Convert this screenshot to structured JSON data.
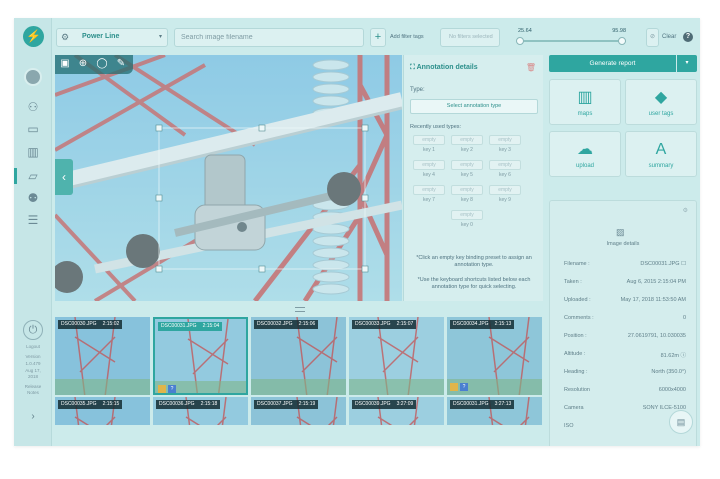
{
  "app": {
    "logo_glyph": "⚡",
    "accent": "#2fa6a0"
  },
  "sidebar": {
    "items": [
      {
        "name": "user-icon",
        "glyph": "⚇"
      },
      {
        "name": "card-icon",
        "glyph": "▭"
      },
      {
        "name": "chart-icon",
        "glyph": "▥"
      },
      {
        "name": "map-icon",
        "glyph": "▱"
      },
      {
        "name": "team-icon",
        "glyph": "⚉"
      },
      {
        "name": "list-icon",
        "glyph": "☰"
      }
    ],
    "power_glyph": "⏻",
    "version_lines": [
      "Logout",
      "Version",
      "1.0.479",
      "Aug 17,",
      "2018",
      "Release",
      "Notes"
    ],
    "expand_glyph": "›"
  },
  "topbar": {
    "project_icon": "⚙",
    "project_name": "Power Line",
    "project_caret": "▾",
    "search_placeholder": "Search image filename",
    "add_filter_glyph": "+",
    "add_filter_label": "Add filter tags",
    "no_filters_label": "No filters selected",
    "range_low": "25.64",
    "range_high": "95.98",
    "range_low_fraction": 0.02,
    "range_high_fraction": 0.96,
    "clear_glyph": "⊘",
    "clear_label": "Clear",
    "help_glyph": "?"
  },
  "viewer": {
    "tools": [
      "▣",
      "⊕",
      "◯",
      "✎"
    ],
    "prev_glyph": "‹"
  },
  "annotation": {
    "title_glyph": "⛶",
    "title": "Annotation details",
    "delete_glyph": "🗑",
    "type_label": "Type:",
    "select_button": "Select annotation type",
    "recent_label": "Recently used types:",
    "keys": [
      {
        "btn": "empty",
        "label": "key 1"
      },
      {
        "btn": "empty",
        "label": "key 2"
      },
      {
        "btn": "empty",
        "label": "key 3"
      },
      {
        "btn": "empty",
        "label": "key 4"
      },
      {
        "btn": "empty",
        "label": "key 5"
      },
      {
        "btn": "empty",
        "label": "key 6"
      },
      {
        "btn": "empty",
        "label": "key 7"
      },
      {
        "btn": "empty",
        "label": "key 8"
      },
      {
        "btn": "empty",
        "label": "key 9"
      },
      {
        "btn": "empty",
        "label": "key 0"
      }
    ],
    "hint1": "*Click an empty key binding preset to assign an annotation type.",
    "hint2": "*Use the keyboard shortcuts listed below each annotation type for quick selecting."
  },
  "right": {
    "generate_report": "Generate report",
    "generate_caret": "▾",
    "tiles": [
      {
        "label": "maps",
        "glyph": "▥",
        "icon": "map-icon"
      },
      {
        "label": "user tags",
        "glyph": "◆",
        "icon": "tag-icon"
      },
      {
        "label": "upload",
        "glyph": "☁",
        "icon": "upload-icon"
      },
      {
        "label": "summary",
        "glyph": "A",
        "icon": "summary-icon"
      }
    ],
    "details": {
      "gear_glyph": "⚙",
      "image_glyph": "▨",
      "title": "Image details",
      "rows": [
        {
          "k": "Filename :",
          "v": "DSC00031.JPG ☐"
        },
        {
          "k": "Taken :",
          "v": "Aug 6, 2015 2:15:04 PM"
        },
        {
          "k": "Uploaded :",
          "v": "May 17, 2018 11:53:50 AM"
        },
        {
          "k": "Comments :",
          "v": "0"
        },
        {
          "k": "Position :",
          "v": "27.0619791, 10.030035"
        },
        {
          "k": "Altitude :",
          "v": "81.62m ⓘ"
        },
        {
          "k": "Heading :",
          "v": "North (350.0°)"
        },
        {
          "k": "Resolution",
          "v": "6000x4000"
        },
        {
          "k": "Camera",
          "v": "SONY ILCE-5100"
        },
        {
          "k": "ISO",
          "v": ""
        }
      ]
    },
    "chat_glyph": "▤"
  },
  "thumbnails": [
    {
      "file": "DSC00030.JPG",
      "time": "2:15:02"
    },
    {
      "file": "DSC00031.JPG",
      "time": "2:15:04",
      "selected": true
    },
    {
      "file": "DSC00032.JPG",
      "time": "2:15:06"
    },
    {
      "file": "DSC00033.JPG",
      "time": "2:15:07"
    },
    {
      "file": "DSC00034.JPG",
      "time": "2:15:13"
    },
    {
      "file": "DSC00035.JPG",
      "time": "2:15:15"
    },
    {
      "file": "DSC00036.JPG",
      "time": "2:15:18"
    },
    {
      "file": "DSC00037.JPG",
      "time": "2:15:19"
    },
    {
      "file": "DSC00039.JPG",
      "time": "3:27:09"
    },
    {
      "file": "DSC00031.JPG",
      "time": "3:27:13"
    }
  ],
  "badge_glyph": "?"
}
